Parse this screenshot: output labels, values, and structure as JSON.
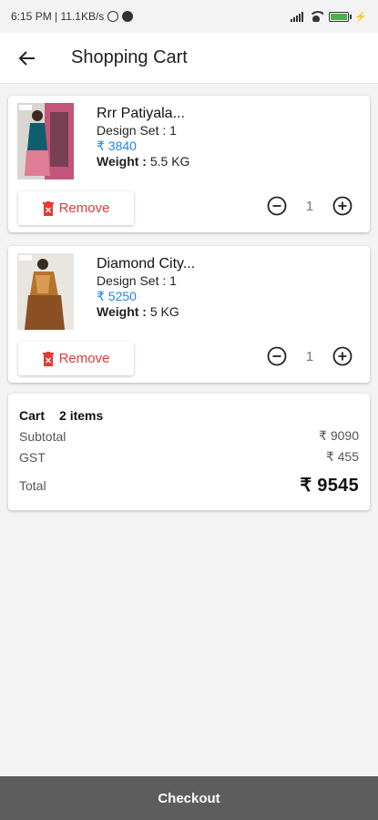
{
  "status_bar": {
    "time_speed": "6:15 PM | 11.1KB/s"
  },
  "header": {
    "title": "Shopping Cart"
  },
  "items": [
    {
      "name": "Rrr Patiyala...",
      "design_label": "Design Set : ",
      "design_value": "1",
      "price": "₹ 3840",
      "weight_label": "Weight : ",
      "weight_value": "5.5 KG",
      "remove_label": "Remove",
      "quantity": "1"
    },
    {
      "name": "Diamond City...",
      "design_label": "Design Set : ",
      "design_value": "1",
      "price": "₹ 5250",
      "weight_label": "Weight : ",
      "weight_value": "5 KG",
      "remove_label": "Remove",
      "quantity": "1"
    }
  ],
  "summary": {
    "cart_label": "Cart",
    "item_count": "2 items",
    "subtotal_label": "Subtotal",
    "subtotal_value": "₹ 9090",
    "gst_label": "GST",
    "gst_value": "₹ 455",
    "total_label": "Total",
    "total_value": "₹ 9545"
  },
  "checkout_label": "Checkout",
  "colors": {
    "price": "#1e88e5",
    "remove": "#e53935",
    "checkout_bg": "#5d5d5d"
  }
}
